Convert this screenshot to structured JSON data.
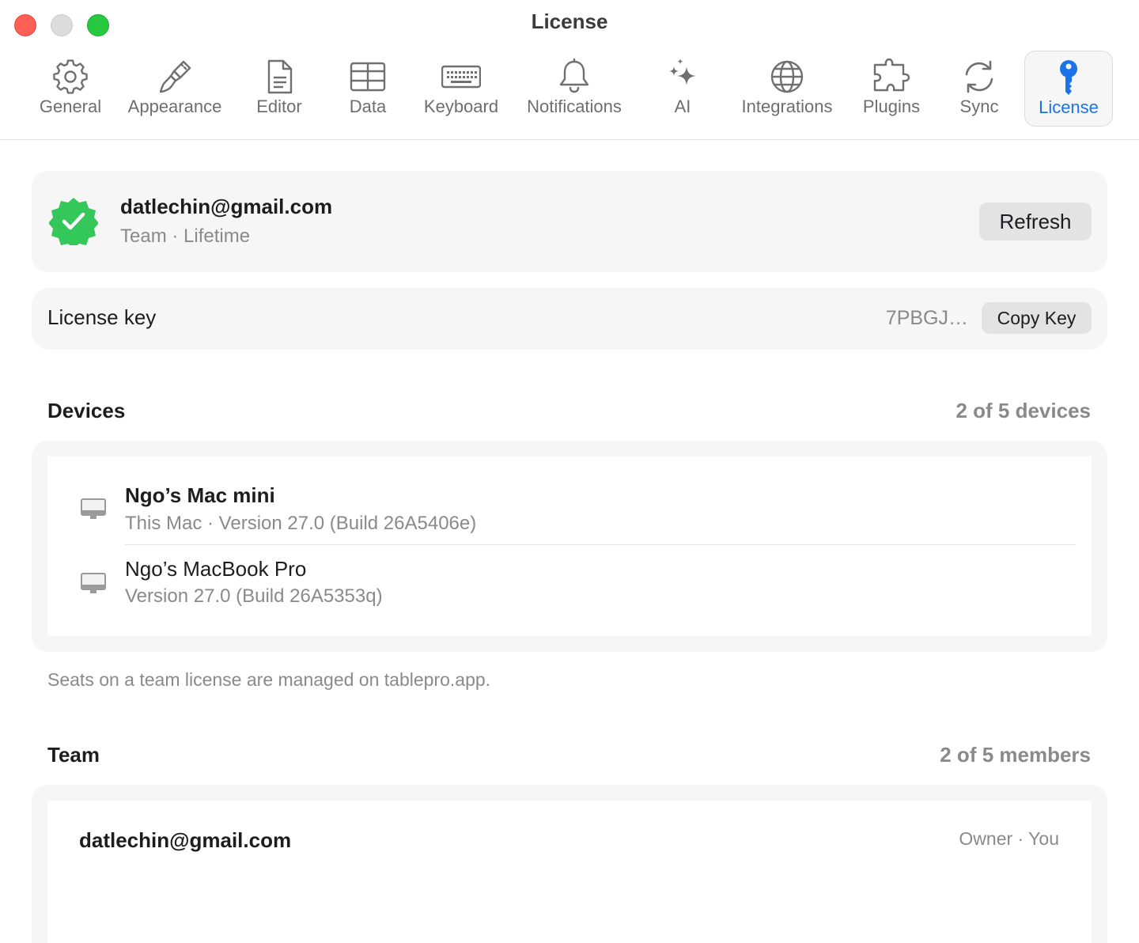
{
  "window": {
    "title": "License"
  },
  "tabs": [
    {
      "id": "general",
      "label": "General",
      "icon": "gear-icon"
    },
    {
      "id": "appearance",
      "label": "Appearance",
      "icon": "paintbrush-icon"
    },
    {
      "id": "editor",
      "label": "Editor",
      "icon": "document-icon"
    },
    {
      "id": "data",
      "label": "Data",
      "icon": "table-icon"
    },
    {
      "id": "keyboard",
      "label": "Keyboard",
      "icon": "keyboard-icon"
    },
    {
      "id": "notifications",
      "label": "Notifications",
      "icon": "bell-icon"
    },
    {
      "id": "ai",
      "label": "AI",
      "icon": "sparkles-icon"
    },
    {
      "id": "integrations",
      "label": "Integrations",
      "icon": "globe-icon"
    },
    {
      "id": "plugins",
      "label": "Plugins",
      "icon": "puzzle-icon"
    },
    {
      "id": "sync",
      "label": "Sync",
      "icon": "sync-icon"
    },
    {
      "id": "license",
      "label": "License",
      "icon": "key-icon",
      "active": true
    }
  ],
  "account": {
    "email": "datlechin@gmail.com",
    "plan": "Team · Lifetime",
    "refresh_label": "Refresh",
    "badge_icon": "verified-badge-icon",
    "badge_color": "#34c759"
  },
  "license_key": {
    "label": "License key",
    "value": "7PBGJ…",
    "copy_label": "Copy Key"
  },
  "devices": {
    "title": "Devices",
    "count": "2 of 5 devices",
    "items": [
      {
        "name": "Ngo’s Mac mini",
        "detail": "This Mac · Version 27.0 (Build 26A5406e)",
        "icon": "desktop-icon"
      },
      {
        "name": "Ngo’s MacBook Pro",
        "detail": "Version 27.0 (Build 26A5353q)",
        "icon": "desktop-icon"
      }
    ],
    "note": "Seats on a team license are managed on tablepro.app."
  },
  "team": {
    "title": "Team",
    "count": "2 of 5 members",
    "members": [
      {
        "email": "datlechin@gmail.com",
        "role": "Owner · You"
      }
    ]
  },
  "colors": {
    "accent": "#1a73e8",
    "verified": "#34c759"
  }
}
